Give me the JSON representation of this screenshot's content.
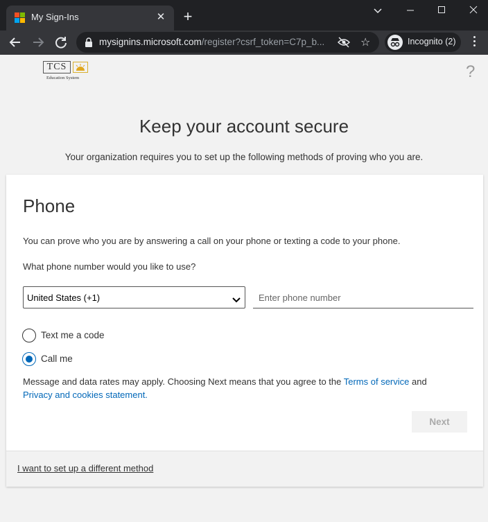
{
  "browser": {
    "tab_title": "My Sign-Ins",
    "url_host": "mysignins.microsoft.com",
    "url_path": "/register?csrf_token=C7p_b...",
    "incognito_label": "Incognito (2)"
  },
  "header": {
    "logo_text": "TCS",
    "logo_subtext": "Education System",
    "help_glyph": "?"
  },
  "page": {
    "title": "Keep your account secure",
    "subtitle": "Your organization requires you to set up the following methods of proving who you are."
  },
  "card": {
    "title": "Phone",
    "description": "You can prove who you are by answering a call on your phone or texting a code to your phone.",
    "question": "What phone number would you like to use?",
    "country_select": {
      "value": "United States (+1)"
    },
    "phone_input": {
      "placeholder": "Enter phone number",
      "value": ""
    },
    "methods": [
      {
        "label": "Text me a code",
        "checked": false
      },
      {
        "label": "Call me",
        "checked": true
      }
    ],
    "legal_prefix": "Message and data rates may apply. Choosing Next means that you agree to the ",
    "terms_link": "Terms of service",
    "legal_and": " and",
    "privacy_link": "Privacy and cookies statement.",
    "next_label": "Next",
    "alt_method_link": "I want to set up a different method"
  },
  "colors": {
    "accent": "#0067b8",
    "chrome_dark": "#202124",
    "chrome_tab": "#35363a"
  }
}
